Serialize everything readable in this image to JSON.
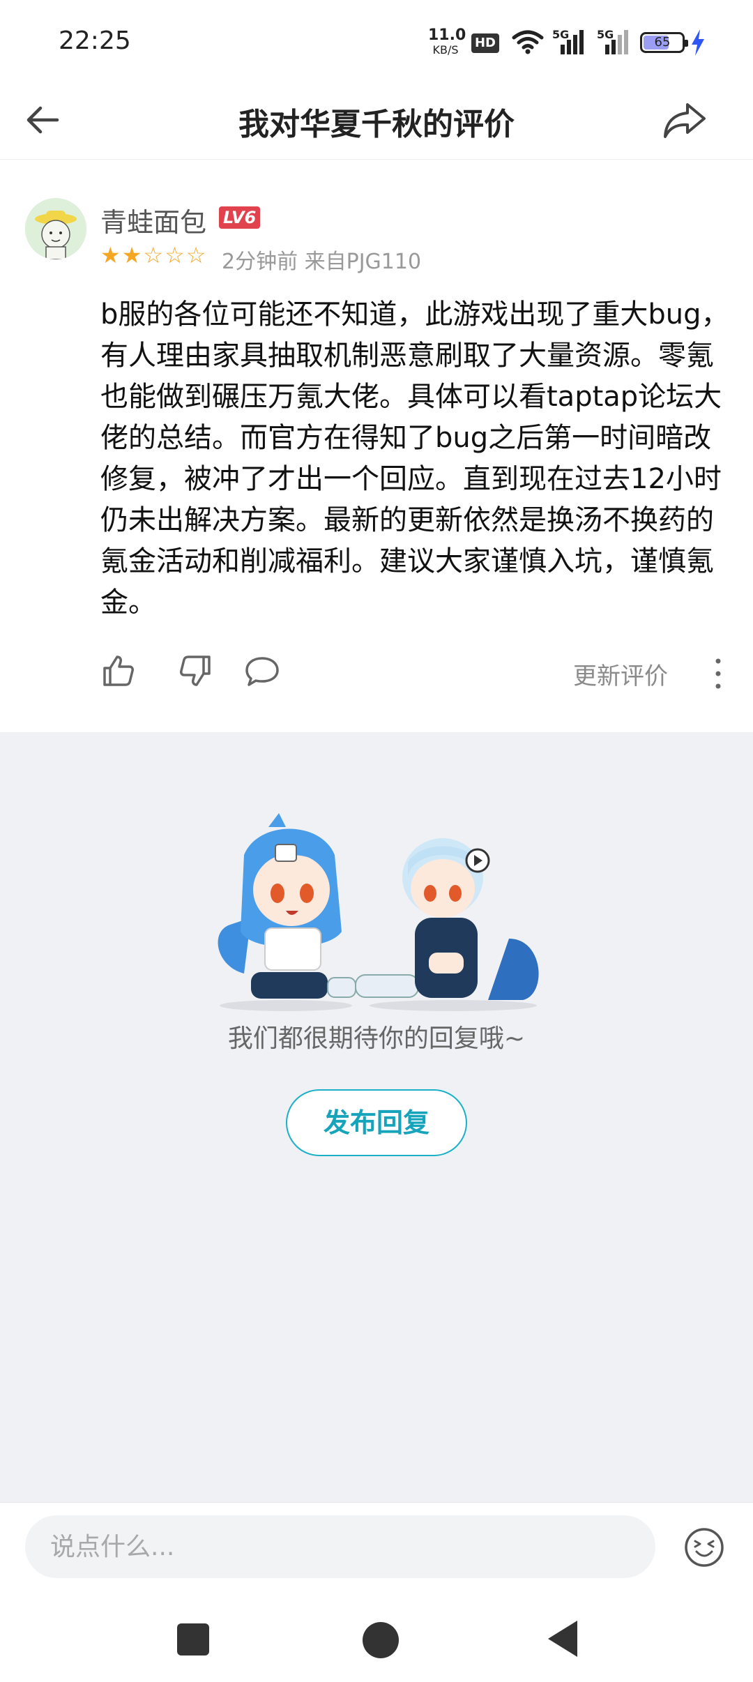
{
  "status_bar": {
    "time": "22:25",
    "net_speed_value": "11.0",
    "net_speed_unit": "KB/S",
    "hd_label": "HD",
    "sig_label_1": "5G",
    "sig_label_2": "5G",
    "battery_percent": "65"
  },
  "header": {
    "title": "我对华夏千秋的评价"
  },
  "review": {
    "username": "青蛙面包",
    "level": "LV6",
    "rating": 2,
    "rating_max": 5,
    "meta": "2分钟前 来自PJG110",
    "content": "b服的各位可能还不知道，此游戏出现了重大bug，有人理由家具抽取机制恶意刷取了大量资源。零氪也能做到碾压万氪大佬。具体可以看taptap论坛大佬的总结。而官方在得知了bug之后第一时间暗改修复，被冲了才出一个回应。直到现在过去12小时仍未出解决方案。最新的更新依然是换汤不换药的氪金活动和削减福利。建议大家谨慎入坑，谨慎氪金。",
    "update_label": "更新评价"
  },
  "empty_state": {
    "text": "我们都很期待你的回复哦~",
    "publish_label": "发布回复"
  },
  "comment_bar": {
    "placeholder": "说点什么..."
  },
  "colors": {
    "star": "#f5a623",
    "level_badge": "#e0434d",
    "accent": "#16a4bd",
    "empty_bg": "#f0f1f4"
  },
  "icons": [
    "back-arrow-icon",
    "share-icon",
    "like-icon",
    "dislike-icon",
    "comment-icon",
    "more-vert-icon",
    "emoji-icon",
    "wifi-icon",
    "signal-icon",
    "bolt-icon"
  ]
}
